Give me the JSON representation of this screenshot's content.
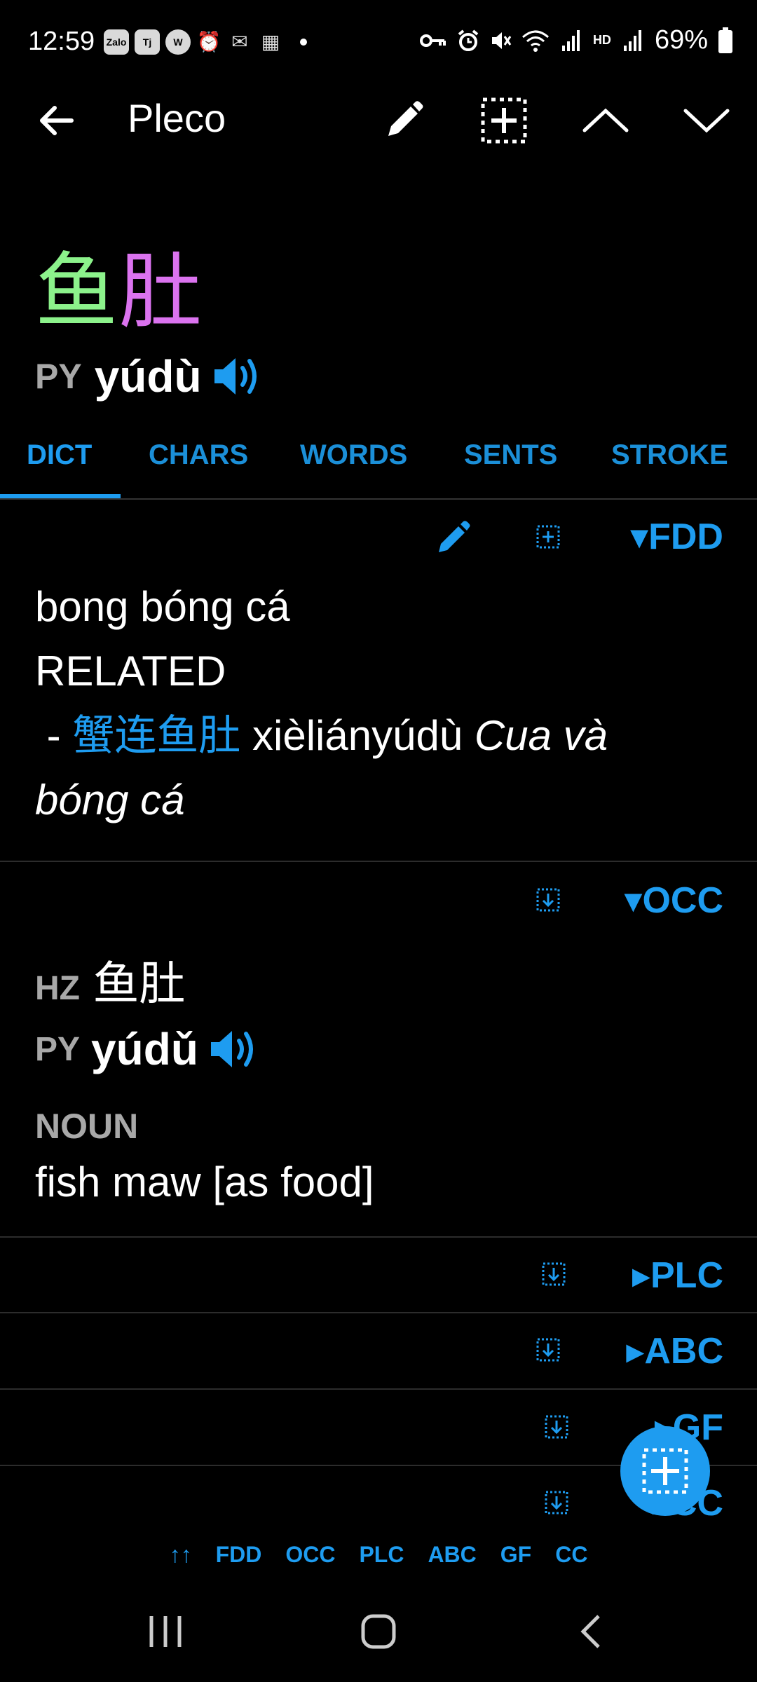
{
  "status_bar": {
    "time": "12:59",
    "notification_icons": [
      "Zalo",
      "Tj",
      "W",
      "⏰",
      "✉",
      "▦"
    ],
    "battery": "69%"
  },
  "app_bar": {
    "title": "Pleco",
    "icons": [
      "back-arrow-icon",
      "pencil-icon",
      "add-flashcard-icon",
      "chevron-up-icon",
      "chevron-down-icon"
    ]
  },
  "headword": {
    "char1": "鱼",
    "char2": "肚",
    "char1_color": "#8cf28b",
    "char2_color": "#db73ef",
    "py_label": "PY",
    "pinyin": "yúdù"
  },
  "tabs": [
    {
      "label": "DICT",
      "active": true
    },
    {
      "label": "CHARS",
      "active": false
    },
    {
      "label": "WORDS",
      "active": false
    },
    {
      "label": "SENTS",
      "active": false
    },
    {
      "label": "STROKE",
      "active": false
    }
  ],
  "entries": {
    "fdd": {
      "tag": "▾FDD",
      "definition": "bong bóng cá",
      "related_label": "RELATED",
      "related_dash": " - ",
      "related_hanzi": "蟹连鱼肚",
      "related_pinyin": " xièliányúdù ",
      "related_meaning_1": "Cua và",
      "related_meaning_2": "bóng cá"
    },
    "occ": {
      "tag": "▾OCC",
      "hz_label": "HZ",
      "hz": "鱼肚",
      "py_label": "PY",
      "pinyin": "yúdǔ",
      "pos": "NOUN",
      "definition": "fish maw [as food]"
    },
    "collapsed": [
      "▸PLC",
      "▸ABC",
      "▸GF",
      "▸CC"
    ]
  },
  "dict_bar": [
    "↑↑",
    "FDD",
    "OCC",
    "PLC",
    "ABC",
    "GF",
    "CC"
  ],
  "accent_color": "#1e9cf0"
}
